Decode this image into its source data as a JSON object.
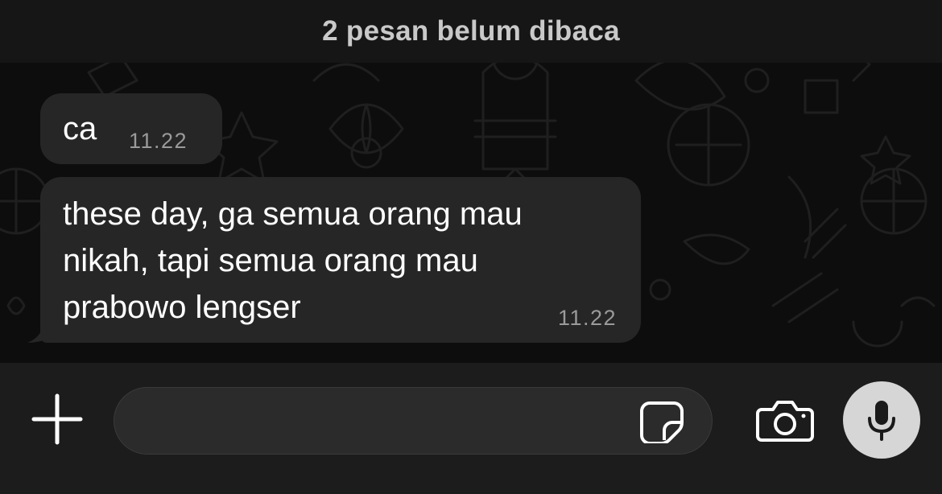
{
  "chat": {
    "unread_banner": "2 pesan belum dibaca",
    "messages": [
      {
        "text": "ca",
        "time": "11.22"
      },
      {
        "text": "these day, ga semua orang mau\nnikah, tapi semua orang mau\nprabowo lengser",
        "time": "11.22"
      }
    ]
  },
  "composer": {
    "input_value": "",
    "input_placeholder": "",
    "icons": {
      "add": "plus-icon",
      "sticker": "sticker-icon",
      "camera": "camera-icon",
      "mic": "microphone-icon"
    }
  },
  "colors": {
    "bubble": "#262626",
    "banner_text": "#c9c9c9",
    "time_text": "#9a9a9a",
    "mic_button": "#d6d6d6"
  }
}
